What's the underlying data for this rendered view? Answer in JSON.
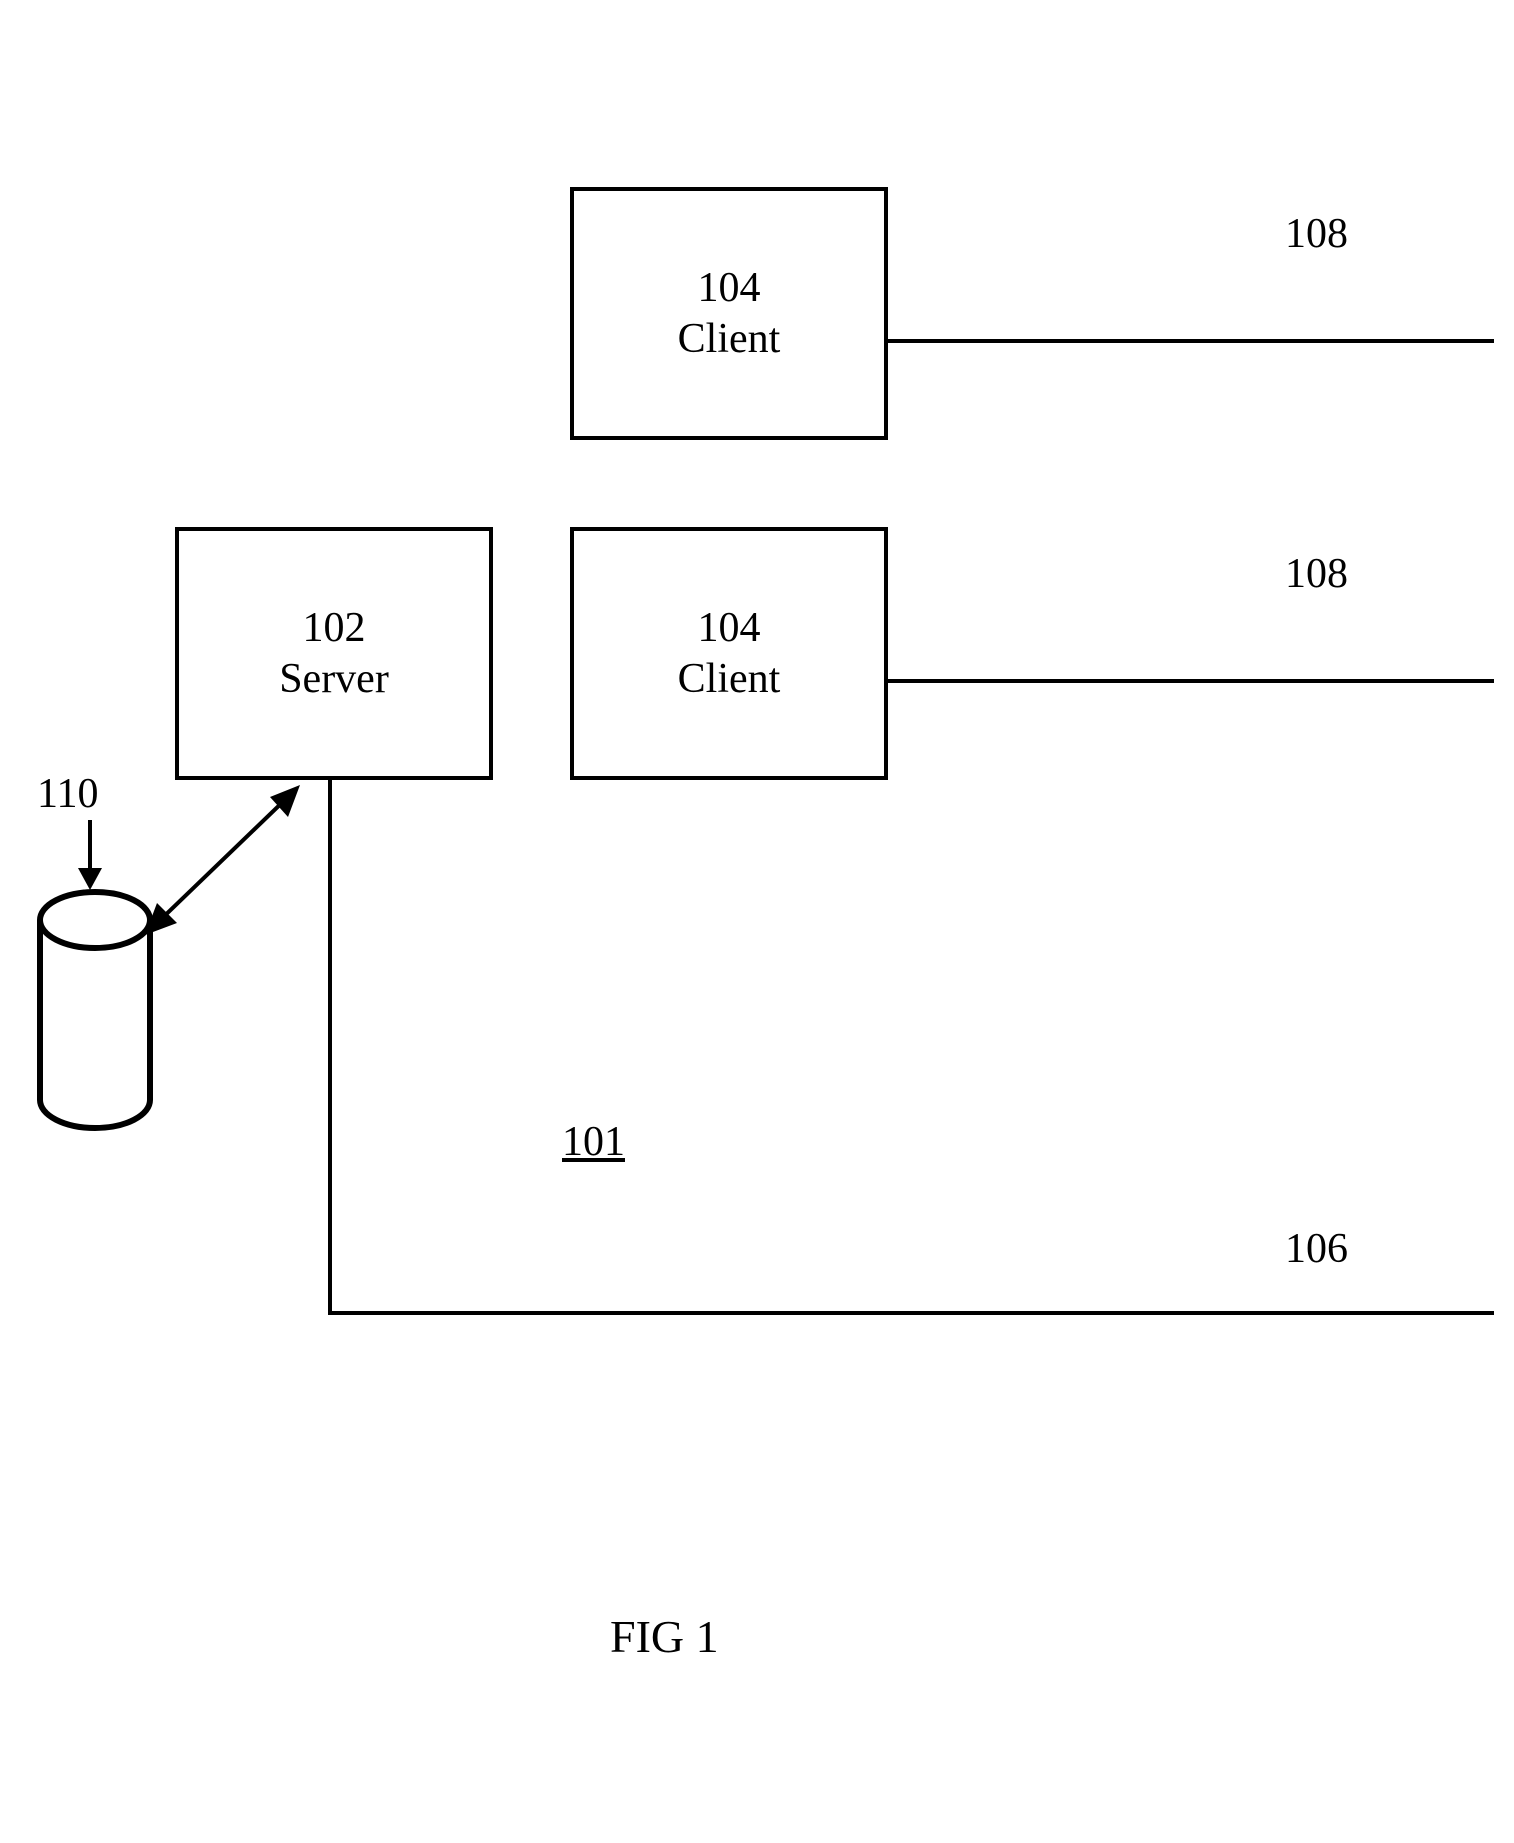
{
  "boxes": {
    "server": {
      "num": "102",
      "name": "Server"
    },
    "client_top": {
      "num": "104",
      "name": "Client"
    },
    "client_mid": {
      "num": "104",
      "name": "Client"
    }
  },
  "labels": {
    "l108a": "108",
    "l108b": "108",
    "l110": "110",
    "l101": "101",
    "l106": "106",
    "figcap": "FIG 1"
  }
}
